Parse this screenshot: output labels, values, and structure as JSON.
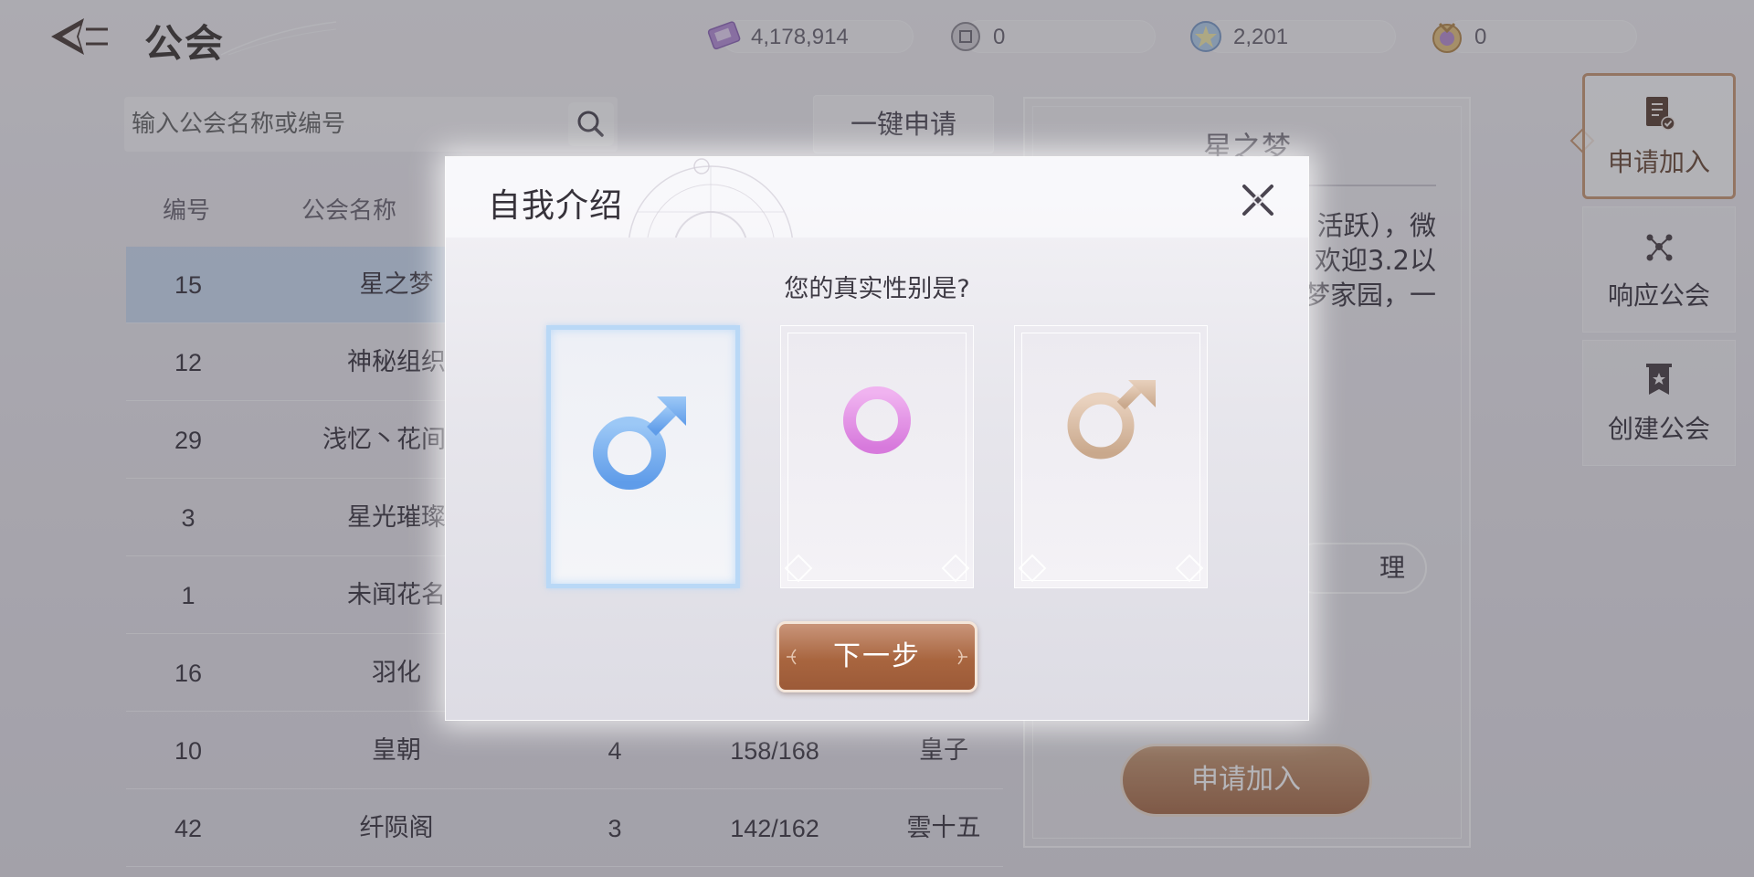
{
  "header": {
    "title": "公会",
    "currencies": [
      {
        "icon": "ticket-icon",
        "value": "4,178,914"
      },
      {
        "icon": "coin-icon",
        "value": "0"
      },
      {
        "icon": "star-crystal-icon",
        "value": "2,201"
      },
      {
        "icon": "medal-icon",
        "value": "0"
      }
    ]
  },
  "search": {
    "placeholder": "输入公会名称或编号",
    "apply_all_label": "一键申请"
  },
  "table": {
    "headers": [
      "编号",
      "公会名称"
    ],
    "rows": [
      {
        "id": "15",
        "name": "星之梦",
        "level": "",
        "members": "",
        "leader": "",
        "selected": true
      },
      {
        "id": "12",
        "name": "神秘组织",
        "level": "",
        "members": "",
        "leader": ""
      },
      {
        "id": "29",
        "name": "浅忆丶花间游",
        "level": "",
        "members": "",
        "leader": ""
      },
      {
        "id": "3",
        "name": "星光璀璨",
        "level": "",
        "members": "",
        "leader": ""
      },
      {
        "id": "1",
        "name": "未闻花名",
        "level": "",
        "members": "",
        "leader": ""
      },
      {
        "id": "16",
        "name": "羽化",
        "level": "",
        "members": "",
        "leader": ""
      },
      {
        "id": "10",
        "name": "皇朝",
        "level": "4",
        "members": "158/168",
        "leader": "皇子"
      },
      {
        "id": "42",
        "name": "纤陨阁",
        "level": "3",
        "members": "142/162",
        "leader": "雲十五"
      }
    ]
  },
  "detail": {
    "title": "星之梦",
    "desc_lines": [
      "活跃），微",
      "欢迎3.2以",
      "梦家园，一"
    ],
    "mini_button_label": "理",
    "apply_label": "申请加入"
  },
  "side_tabs": [
    {
      "label": "申请加入",
      "icon": "document-check-icon",
      "active": true
    },
    {
      "label": "响应公会",
      "icon": "network-icon",
      "active": false
    },
    {
      "label": "创建公会",
      "icon": "banner-icon",
      "active": false
    }
  ],
  "modal": {
    "title": "自我介绍",
    "question": "您的真实性别是?",
    "options": [
      {
        "icon": "male-icon",
        "color": "#6aa8ef",
        "selected": true
      },
      {
        "icon": "female-icon",
        "color": "#e391e4",
        "selected": false
      },
      {
        "icon": "other-gender-icon",
        "color": "#d8bba3",
        "selected": false
      }
    ],
    "next_label": "下一步"
  },
  "colors": {
    "accent_brown": "#a8653f",
    "selected_row": "#c4d7f0",
    "selected_card_border": "#b9d8f6"
  }
}
